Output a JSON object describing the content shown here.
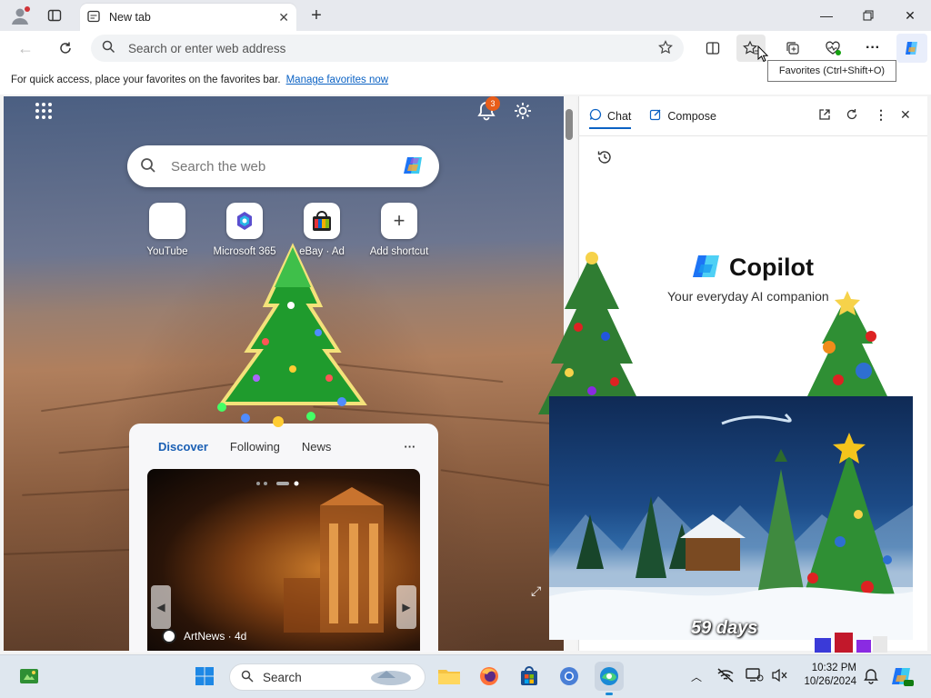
{
  "browser": {
    "tab_title": "New tab",
    "address_placeholder": "Search or enter web address",
    "favorites_hint": "For quick access, place your favorites on the favorites bar.",
    "favorites_link": "Manage favorites now",
    "tooltip": "Favorites (Ctrl+Shift+O)"
  },
  "ntp": {
    "notification_count": "3",
    "search_placeholder": "Search the web",
    "shortcuts": [
      {
        "label": "YouTube"
      },
      {
        "label": "Microsoft 365"
      },
      {
        "label": "eBay · Ad"
      },
      {
        "label": "Add shortcut"
      }
    ],
    "feed_tabs": [
      "Discover",
      "Following",
      "News"
    ],
    "feed_more": "···",
    "article_source": "ArtNews · 4d"
  },
  "copilot": {
    "tabs": [
      "Chat",
      "Compose"
    ],
    "title": "Copilot",
    "tagline": "Your everyday AI companion"
  },
  "widget": {
    "countdown": "59 days"
  },
  "taskbar": {
    "search_placeholder": "Search",
    "time": "10:32 PM",
    "date": "10/26/2024"
  },
  "colors": {
    "accent": "#0b62c4",
    "copilot_blue": "#1d74f5",
    "taskbar": "#dfe7ef"
  }
}
